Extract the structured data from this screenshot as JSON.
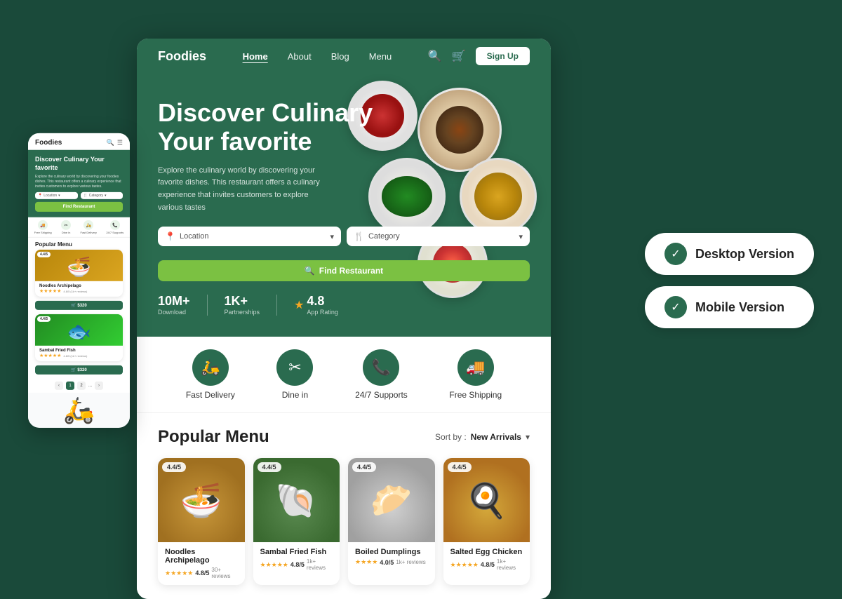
{
  "app": {
    "name": "Foodies",
    "background_color": "#1a4a3a"
  },
  "versions": [
    {
      "id": "desktop",
      "label": "Desktop Version",
      "icon": "✓"
    },
    {
      "id": "mobile",
      "label": "Mobile Version",
      "icon": "✓"
    }
  ],
  "nav": {
    "logo": "Foodies",
    "links": [
      {
        "id": "home",
        "label": "Home",
        "active": true
      },
      {
        "id": "about",
        "label": "About",
        "active": false
      },
      {
        "id": "blog",
        "label": "Blog",
        "active": false
      },
      {
        "id": "menu",
        "label": "Menu",
        "active": false
      }
    ],
    "signup_label": "Sign Up"
  },
  "hero": {
    "title_line1": "Discover Culinary",
    "title_line2": "Your favorite",
    "description": "Explore the culinary world by discovering your favorite dishes. This restaurant offers a culinary experience that invites customers to explore various tastes",
    "location_placeholder": "Location",
    "category_placeholder": "Category",
    "find_btn_label": "Find Restaurant",
    "stats": [
      {
        "number": "10M+",
        "label": "Download"
      },
      {
        "number": "1K+",
        "label": "Partnerships"
      },
      {
        "number": "4.8",
        "label": "App Rating",
        "has_star": true
      }
    ]
  },
  "features": [
    {
      "id": "fast-delivery",
      "label": "Fast Delivery",
      "icon": "🛵"
    },
    {
      "id": "dine-in",
      "label": "Dine in",
      "icon": "✂"
    },
    {
      "id": "247-supports",
      "label": "24/7 Supports",
      "icon": "📞"
    },
    {
      "id": "free-shipping",
      "label": "Free Shipping",
      "icon": "🚚"
    }
  ],
  "popular_menu": {
    "title": "Popular Menu",
    "sort_label": "Sort by :",
    "sort_value": "New Arrivals",
    "items": [
      {
        "id": "noodles",
        "name": "Noodles Archipelago",
        "rating": "4.4/5",
        "stars": 4.8,
        "reviews": "30+ reviews",
        "badge_color": "#f0f0f0"
      },
      {
        "id": "sambal-fish",
        "name": "Sambal Fried Fish",
        "rating": "4.4/5",
        "stars": 4.8,
        "reviews": "1k+ reviews",
        "badge_color": "#f0f0f0"
      },
      {
        "id": "dumplings",
        "name": "Boiled Dumplings",
        "rating": "4.4/5",
        "stars": 4.0,
        "reviews": "1k+ reviews",
        "badge_color": "#f0f0f0"
      },
      {
        "id": "chicken",
        "name": "Salted Egg Chicken",
        "rating": "4.4/5",
        "stars": 4.8,
        "reviews": "1k+ reviews",
        "badge_color": "#f0f0f0"
      }
    ]
  },
  "mobile": {
    "logo": "Foodies",
    "hero_title": "Discover Culinary Your favorite",
    "hero_desc": "Explore the culinary world by discovering your foodies dishes. This restaurant offers a culinary experience that invites customers to explore various tastes.",
    "location_placeholder": "Location",
    "category_placeholder": "Category",
    "find_btn": "Find Restaurant",
    "features": [
      "Free Shipping",
      "Dine in",
      "Fast Delivery",
      "24/7 Supports"
    ],
    "section_title": "Popular Menu",
    "cards": [
      {
        "name": "Noodles Archipelago",
        "rating": "4.4/5",
        "stars": "4.8/5",
        "reviews": "1k+ reviews",
        "price": "$320"
      },
      {
        "name": "Sambal Fried Fish",
        "rating": "4.4/5",
        "stars": "4.8/5",
        "reviews": "1k+ reviews",
        "price": "$320"
      }
    ],
    "pagination": [
      "<",
      "1",
      "2",
      "...",
      ">"
    ]
  }
}
